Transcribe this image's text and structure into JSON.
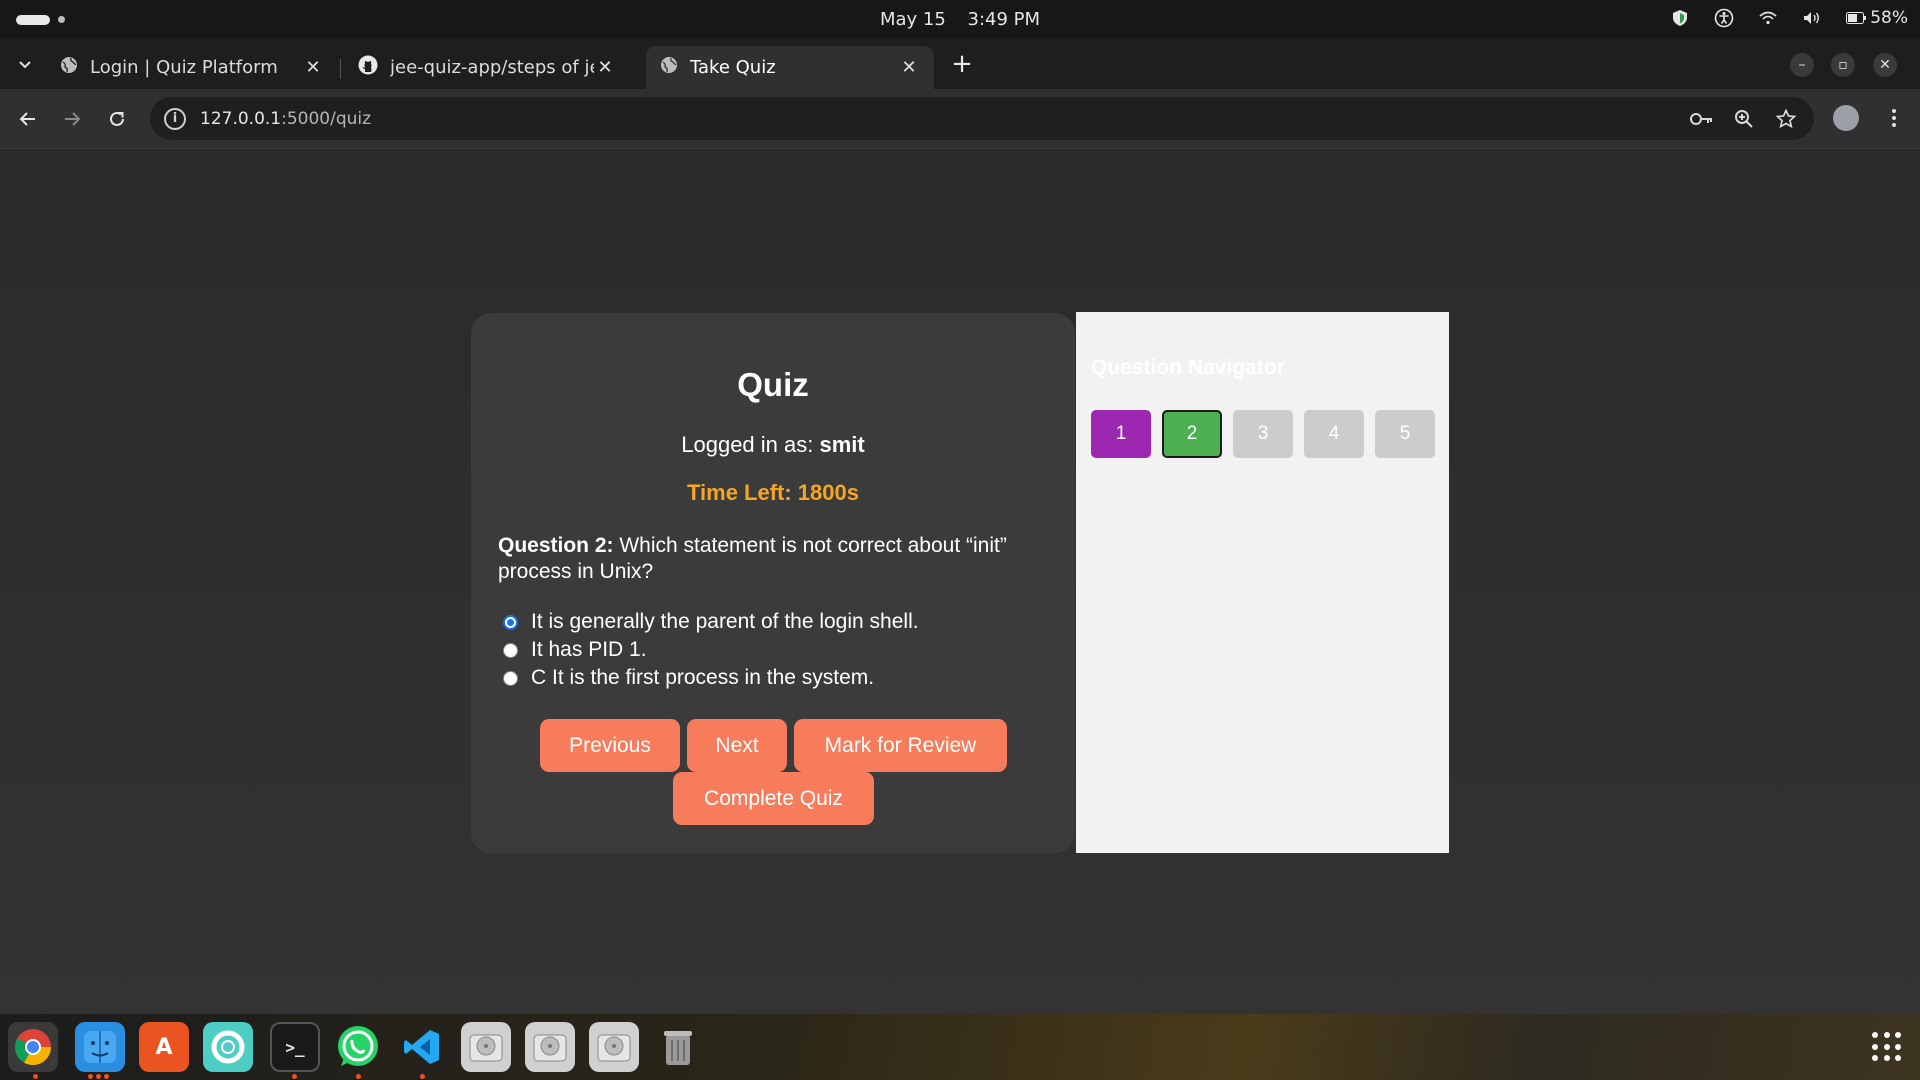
{
  "system": {
    "date": "May 15",
    "time": "3:49 PM",
    "battery": "58%"
  },
  "browser": {
    "tabs": [
      {
        "title": "Login | Quiz Platform",
        "icon": "globe-icon",
        "active": false
      },
      {
        "title": "jee-quiz-app/steps of jee",
        "icon": "github-icon",
        "active": false
      },
      {
        "title": "Take Quiz",
        "icon": "globe-icon",
        "active": true
      }
    ],
    "url_host": "127.0.0.1",
    "url_path": ":5000/quiz"
  },
  "quiz": {
    "title": "Quiz",
    "logged_in_label": "Logged in as: ",
    "username": "smit",
    "timer": "Time Left: 1800s",
    "question_label": "Question 2:",
    "question_text": " Which statement is not correct about “init” process in Unix?",
    "options": [
      {
        "text": "It is generally the parent of the login shell.",
        "selected": true
      },
      {
        "text": "It has PID 1.",
        "selected": false
      },
      {
        "text": "C It is the first process in the system.",
        "selected": false
      }
    ],
    "buttons": {
      "previous": "Previous",
      "next": "Next",
      "mark_review": "Mark for Review",
      "complete": "Complete Quiz"
    }
  },
  "navigator": {
    "title": "Question Navigator",
    "questions": [
      {
        "label": "1",
        "status": "marked-review",
        "color": "#9c27b0"
      },
      {
        "label": "2",
        "status": "current-answered",
        "color": "#4caf50"
      },
      {
        "label": "3",
        "status": "unvisited",
        "color": "#cccccc"
      },
      {
        "label": "4",
        "status": "unvisited",
        "color": "#cccccc"
      },
      {
        "label": "5",
        "status": "unvisited",
        "color": "#cccccc"
      }
    ]
  },
  "dock": {
    "apps": [
      "chrome-icon",
      "files-icon",
      "app-center-icon",
      "help-icon",
      "terminal-icon",
      "whatsapp-icon",
      "vscode-icon",
      "drive-icon",
      "drive-icon",
      "drive-icon",
      "trash-icon"
    ]
  },
  "colors": {
    "accent": "#f67c5c",
    "timer": "#f5a623"
  }
}
